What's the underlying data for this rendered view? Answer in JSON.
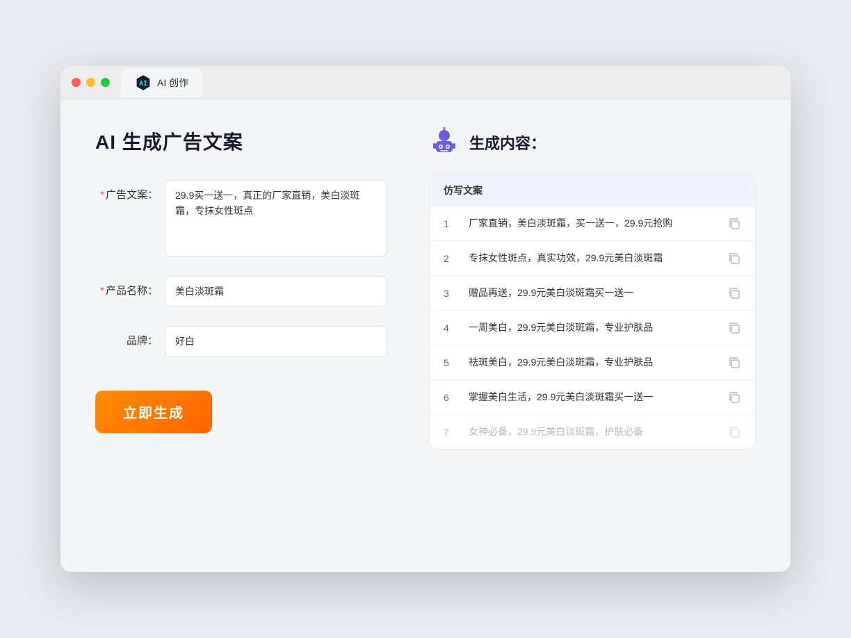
{
  "browser": {
    "tab_label": "AI 创作"
  },
  "page": {
    "title": "AI 生成广告文案"
  },
  "form": {
    "ad_copy_label": "广告文案：",
    "ad_copy_required": "*",
    "ad_copy_value": "29.9买一送一，真正的厂家直销，美白淡斑霜，专抹女性斑点",
    "product_name_label": "产品名称：",
    "product_name_required": "*",
    "product_name_value": "美白淡斑霜",
    "brand_label": "品牌：",
    "brand_value": "好白",
    "generate_button": "立即生成"
  },
  "result": {
    "title": "生成内容：",
    "table_header": "仿写文案",
    "items": [
      {
        "num": "1",
        "text": "厂家直销，美白淡斑霜，买一送一，29.9元抢购",
        "faded": false
      },
      {
        "num": "2",
        "text": "专抹女性斑点，真实功效，29.9元美白淡斑霜",
        "faded": false
      },
      {
        "num": "3",
        "text": "赠品再送，29.9元美白淡斑霜买一送一",
        "faded": false
      },
      {
        "num": "4",
        "text": "一周美白，29.9元美白淡斑霜，专业护肤品",
        "faded": false
      },
      {
        "num": "5",
        "text": "祛斑美白，29.9元美白淡斑霜，专业护肤品",
        "faded": false
      },
      {
        "num": "6",
        "text": "掌握美白生活，29.9元美白淡斑霜买一送一",
        "faded": false
      },
      {
        "num": "7",
        "text": "女神必备，29.9元美白淡斑霜，护肤必备",
        "faded": true
      }
    ]
  }
}
